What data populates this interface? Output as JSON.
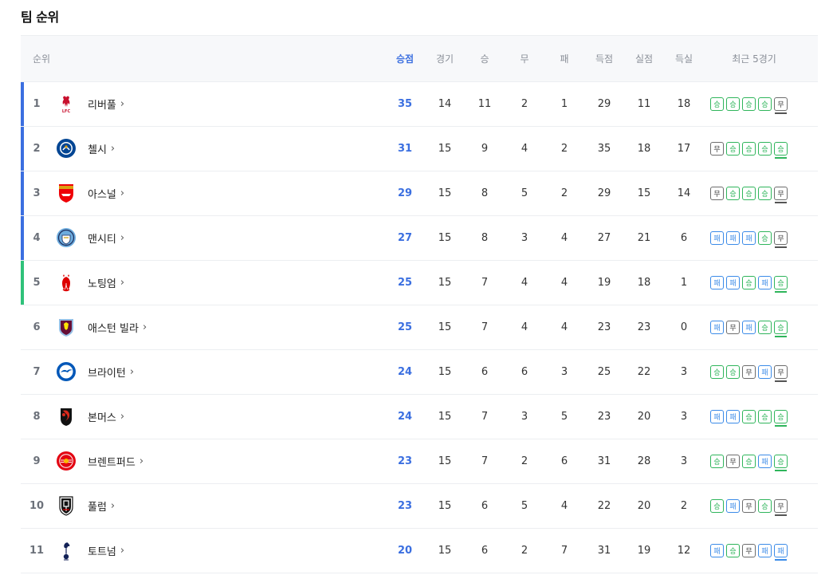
{
  "section_title": "팀 순위",
  "headers": {
    "rank": "순위",
    "points": "승점",
    "played": "경기",
    "won": "승",
    "drawn": "무",
    "lost": "패",
    "gf": "득점",
    "ga": "실점",
    "gd": "득실",
    "form": "최근 5경기"
  },
  "zone_colors": {
    "champions": "#3b6fe0",
    "europa": "#2fc27a"
  },
  "form_letters": {
    "W": "승",
    "D": "무",
    "L": "패"
  },
  "teams": [
    {
      "rank": "1",
      "name": "리버풀",
      "logo": "liverpool-crest-icon",
      "zone": "champions",
      "points": "35",
      "played": "14",
      "won": "11",
      "drawn": "2",
      "lost": "1",
      "gf": "29",
      "ga": "11",
      "gd": "18",
      "form": [
        "W",
        "W",
        "W",
        "W",
        "D"
      ]
    },
    {
      "rank": "2",
      "name": "첼시",
      "logo": "chelsea-crest-icon",
      "zone": "champions",
      "points": "31",
      "played": "15",
      "won": "9",
      "drawn": "4",
      "lost": "2",
      "gf": "35",
      "ga": "18",
      "gd": "17",
      "form": [
        "D",
        "W",
        "W",
        "W",
        "W"
      ]
    },
    {
      "rank": "3",
      "name": "아스널",
      "logo": "arsenal-crest-icon",
      "zone": "champions",
      "points": "29",
      "played": "15",
      "won": "8",
      "drawn": "5",
      "lost": "2",
      "gf": "29",
      "ga": "15",
      "gd": "14",
      "form": [
        "D",
        "W",
        "W",
        "W",
        "D"
      ]
    },
    {
      "rank": "4",
      "name": "맨시티",
      "logo": "man-city-crest-icon",
      "zone": "champions",
      "points": "27",
      "played": "15",
      "won": "8",
      "drawn": "3",
      "lost": "4",
      "gf": "27",
      "ga": "21",
      "gd": "6",
      "form": [
        "L",
        "L",
        "L",
        "W",
        "D"
      ]
    },
    {
      "rank": "5",
      "name": "노팅엄",
      "logo": "nottingham-crest-icon",
      "zone": "europa",
      "points": "25",
      "played": "15",
      "won": "7",
      "drawn": "4",
      "lost": "4",
      "gf": "19",
      "ga": "18",
      "gd": "1",
      "form": [
        "L",
        "L",
        "W",
        "L",
        "W"
      ]
    },
    {
      "rank": "6",
      "name": "애스턴 빌라",
      "logo": "aston-villa-crest-icon",
      "zone": "",
      "points": "25",
      "played": "15",
      "won": "7",
      "drawn": "4",
      "lost": "4",
      "gf": "23",
      "ga": "23",
      "gd": "0",
      "form": [
        "L",
        "D",
        "L",
        "W",
        "W"
      ]
    },
    {
      "rank": "7",
      "name": "브라이턴",
      "logo": "brighton-crest-icon",
      "zone": "",
      "points": "24",
      "played": "15",
      "won": "6",
      "drawn": "6",
      "lost": "3",
      "gf": "25",
      "ga": "22",
      "gd": "3",
      "form": [
        "W",
        "W",
        "D",
        "L",
        "D"
      ]
    },
    {
      "rank": "8",
      "name": "본머스",
      "logo": "bournemouth-crest-icon",
      "zone": "",
      "points": "24",
      "played": "15",
      "won": "7",
      "drawn": "3",
      "lost": "5",
      "gf": "23",
      "ga": "20",
      "gd": "3",
      "form": [
        "L",
        "L",
        "W",
        "W",
        "W"
      ]
    },
    {
      "rank": "9",
      "name": "브렌트퍼드",
      "logo": "brentford-crest-icon",
      "zone": "",
      "points": "23",
      "played": "15",
      "won": "7",
      "drawn": "2",
      "lost": "6",
      "gf": "31",
      "ga": "28",
      "gd": "3",
      "form": [
        "W",
        "D",
        "W",
        "L",
        "W"
      ]
    },
    {
      "rank": "10",
      "name": "풀럼",
      "logo": "fulham-crest-icon",
      "zone": "",
      "points": "23",
      "played": "15",
      "won": "6",
      "drawn": "5",
      "lost": "4",
      "gf": "22",
      "ga": "20",
      "gd": "2",
      "form": [
        "W",
        "L",
        "D",
        "W",
        "D"
      ]
    },
    {
      "rank": "11",
      "name": "토트넘",
      "logo": "tottenham-crest-icon",
      "zone": "",
      "points": "20",
      "played": "15",
      "won": "6",
      "drawn": "2",
      "lost": "7",
      "gf": "31",
      "ga": "19",
      "gd": "12",
      "form": [
        "L",
        "W",
        "D",
        "L",
        "L"
      ]
    }
  ]
}
